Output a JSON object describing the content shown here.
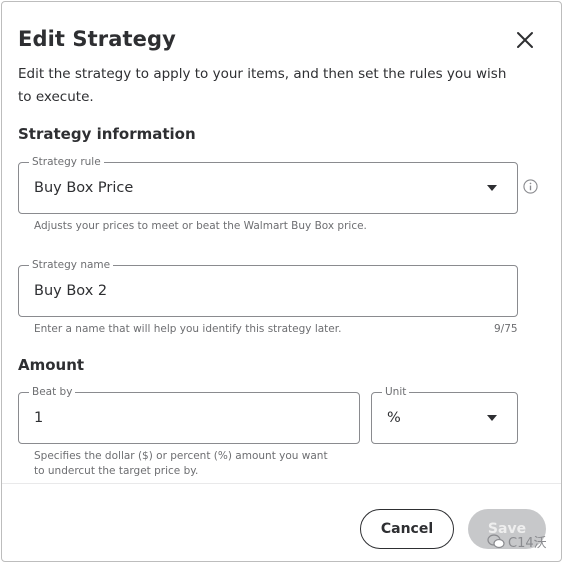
{
  "dialog": {
    "title": "Edit Strategy",
    "intro": "Edit the strategy to apply to your items, and then set the rules you wish to execute."
  },
  "strategy_information": {
    "heading": "Strategy information",
    "rule": {
      "legend": "Strategy rule",
      "value": "Buy Box Price",
      "helper": "Adjusts your prices to meet or beat the Walmart Buy Box price."
    },
    "name": {
      "legend": "Strategy name",
      "value": "Buy Box 2",
      "helper": "Enter a name that will help you identify this strategy later.",
      "counter": "9/75"
    }
  },
  "amount": {
    "heading": "Amount",
    "beat_by": {
      "legend": "Beat by",
      "value": "1"
    },
    "unit": {
      "legend": "Unit",
      "value": "%"
    },
    "helper": "Specifies the dollar ($) or percent (%) amount you want to undercut the target price by."
  },
  "footer": {
    "cancel_label": "Cancel",
    "save_label": "Save"
  },
  "watermark": {
    "text": "C14沃"
  },
  "icons": [
    "close-icon",
    "chevron-down-icon",
    "info-icon",
    "wechat-icon"
  ],
  "colors": {
    "text": "#2e2f32",
    "muted": "#6d6e71",
    "border": "#8a8b8f",
    "disabled_button": "#c7c8ca"
  }
}
